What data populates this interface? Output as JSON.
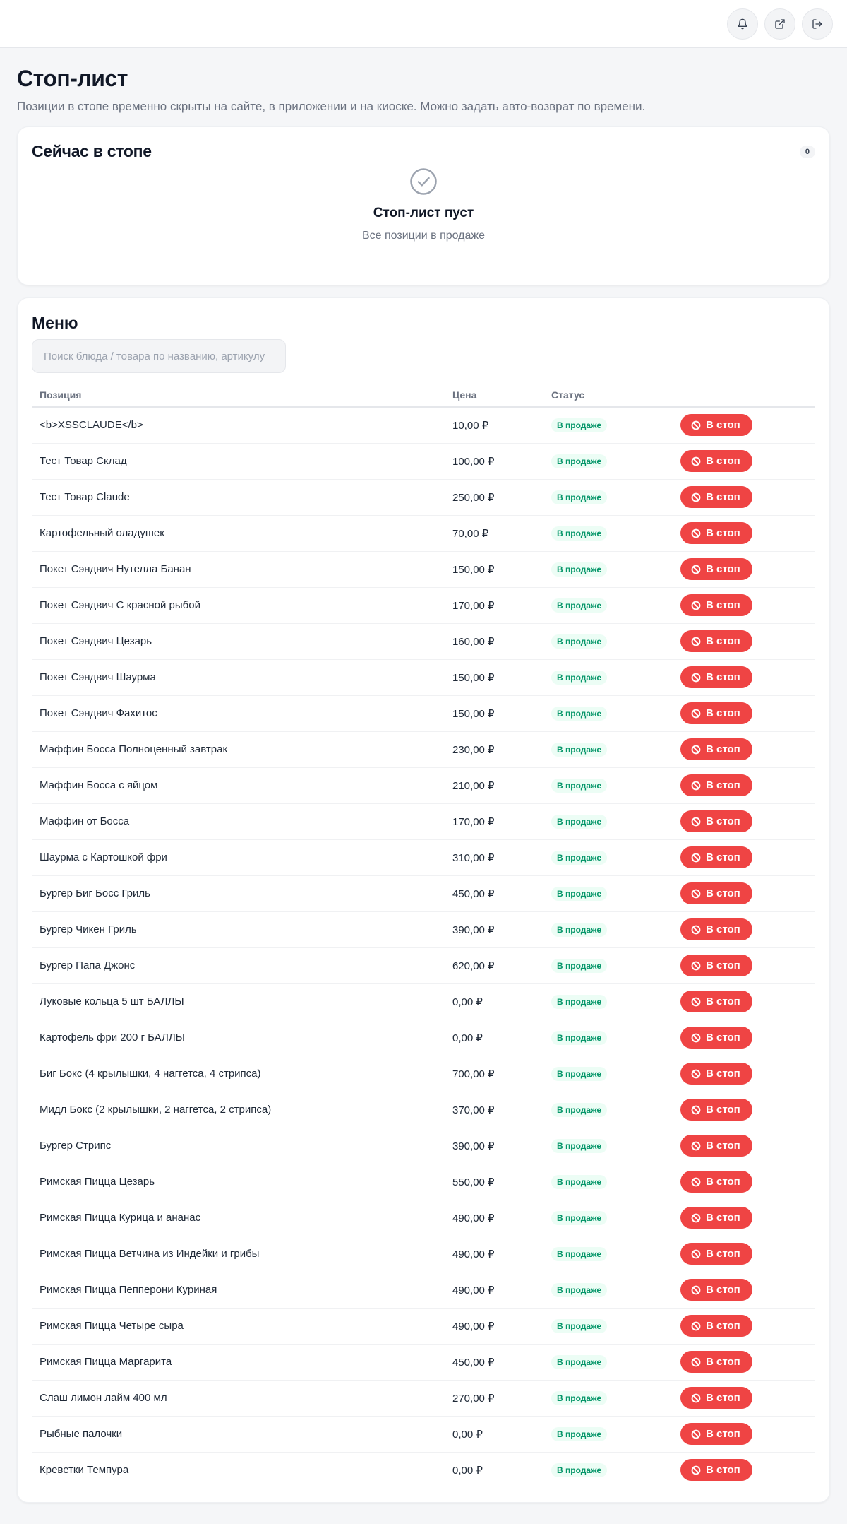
{
  "header": {
    "icons": [
      "bell-icon",
      "external-link-icon",
      "logout-icon"
    ]
  },
  "page": {
    "title": "Стоп-лист",
    "subtitle": "Позиции в стопе временно скрыты на сайте, в приложении и на киоске. Можно задать авто-возврат по времени."
  },
  "stop_card": {
    "title": "Сейчас в стопе",
    "count": "0",
    "empty_title": "Стоп-лист пуст",
    "empty_subtitle": "Все позиции в продаже"
  },
  "menu": {
    "title": "Меню",
    "search_placeholder": "Поиск блюда / товара по названию, артикулу",
    "columns": {
      "name": "Позиция",
      "price": "Цена",
      "status": "Статус"
    },
    "status_label": "В продаже",
    "stop_label": "В стоп",
    "items": [
      {
        "name": "<b>XSSCLAUDE</b>",
        "price": "10,00 ₽"
      },
      {
        "name": "Тест Товар Склад",
        "price": "100,00 ₽"
      },
      {
        "name": "Тест Товар Claude",
        "price": "250,00 ₽"
      },
      {
        "name": "Картофельный оладушек",
        "price": "70,00 ₽"
      },
      {
        "name": "Покет Сэндвич Нутелла Банан",
        "price": "150,00 ₽"
      },
      {
        "name": "Покет Сэндвич С красной рыбой",
        "price": "170,00 ₽"
      },
      {
        "name": "Покет Сэндвич Цезарь",
        "price": "160,00 ₽"
      },
      {
        "name": "Покет Сэндвич Шаурма",
        "price": "150,00 ₽"
      },
      {
        "name": "Покет Сэндвич Фахитос",
        "price": "150,00 ₽"
      },
      {
        "name": "Маффин Босса Полноценный завтрак",
        "price": "230,00 ₽"
      },
      {
        "name": "Маффин Босса с яйцом",
        "price": "210,00 ₽"
      },
      {
        "name": "Маффин от Босса",
        "price": "170,00 ₽"
      },
      {
        "name": "Шаурма с Картошкой фри",
        "price": "310,00 ₽"
      },
      {
        "name": "Бургер Биг Босс Гриль",
        "price": "450,00 ₽"
      },
      {
        "name": "Бургер Чикен Гриль",
        "price": "390,00 ₽"
      },
      {
        "name": "Бургер Папа Джонс",
        "price": "620,00 ₽"
      },
      {
        "name": "Луковые кольца 5 шт БАЛЛЫ",
        "price": "0,00 ₽"
      },
      {
        "name": "Картофель фри 200 г БАЛЛЫ",
        "price": "0,00 ₽"
      },
      {
        "name": "Биг Бокс (4 крылышки, 4 наггетса, 4 стрипса)",
        "price": "700,00 ₽"
      },
      {
        "name": "Мидл Бокс (2 крылышки, 2 наггетса, 2 стрипса)",
        "price": "370,00 ₽"
      },
      {
        "name": "Бургер Стрипс",
        "price": "390,00 ₽"
      },
      {
        "name": "Римская Пицца Цезарь",
        "price": "550,00 ₽"
      },
      {
        "name": "Римская Пицца Курица и ананас",
        "price": "490,00 ₽"
      },
      {
        "name": "Римская Пицца Ветчина из Индейки и грибы",
        "price": "490,00 ₽"
      },
      {
        "name": "Римская Пицца Пепперони Куриная",
        "price": "490,00 ₽"
      },
      {
        "name": "Римская Пицца Четыре сыра",
        "price": "490,00 ₽"
      },
      {
        "name": "Римская Пицца Маргарита",
        "price": "450,00 ₽"
      },
      {
        "name": "Слаш лимон лайм 400 мл",
        "price": "270,00 ₽"
      },
      {
        "name": "Рыбные палочки",
        "price": "0,00 ₽"
      },
      {
        "name": "Креветки Темпура",
        "price": "0,00 ₽"
      }
    ]
  },
  "colors": {
    "accent_red": "#ef4444",
    "status_green": "#059669",
    "status_green_bg": "#ecfdf5"
  }
}
